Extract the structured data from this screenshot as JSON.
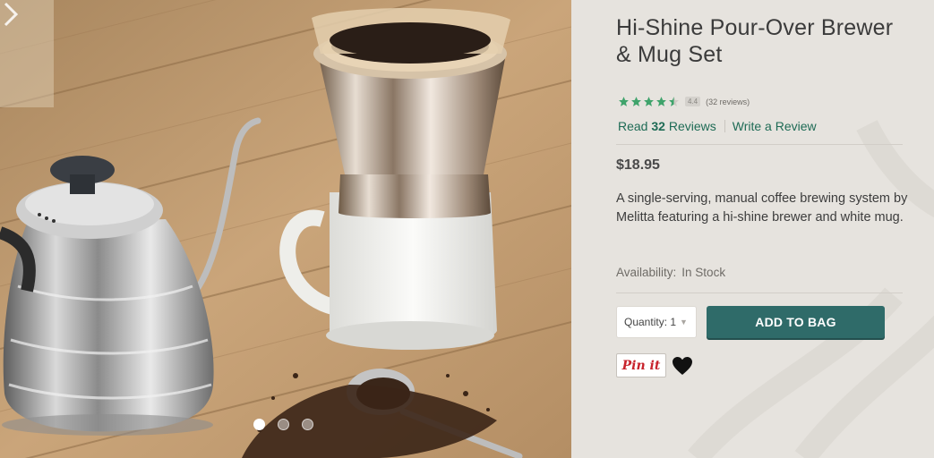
{
  "product": {
    "title": "Hi-Shine Pour-Over Brewer & Mug Set",
    "rating": {
      "stars": 4.5,
      "score": "4.4",
      "count_text": "(32 reviews)"
    },
    "review_links": {
      "read_prefix": "Read",
      "read_count": "32",
      "read_suffix": "Reviews",
      "write": "Write a Review"
    },
    "price": "$18.95",
    "description": "A single-serving, manual coffee brewing system by Melitta featuring a hi-shine brewer and white mug.",
    "availability": {
      "label": "Availability:",
      "value": "In Stock"
    }
  },
  "purchase": {
    "quantity_label": "Quantity: 1",
    "add_to_bag": "ADD TO BAG",
    "pin_it": "Pin it"
  },
  "carousel": {
    "slide_count": 3,
    "active_index": 0
  },
  "colors": {
    "brand_green": "#1e6b55",
    "button_teal": "#2f6b69",
    "star_green": "#3fa36b",
    "panel_bg": "#e6e3de",
    "pin_red": "#c8232c"
  },
  "icons": {
    "carousel_next": "chevron-right-icon",
    "rating": "star-icon",
    "wishlist": "heart-icon",
    "dropdown": "caret-down-icon"
  }
}
